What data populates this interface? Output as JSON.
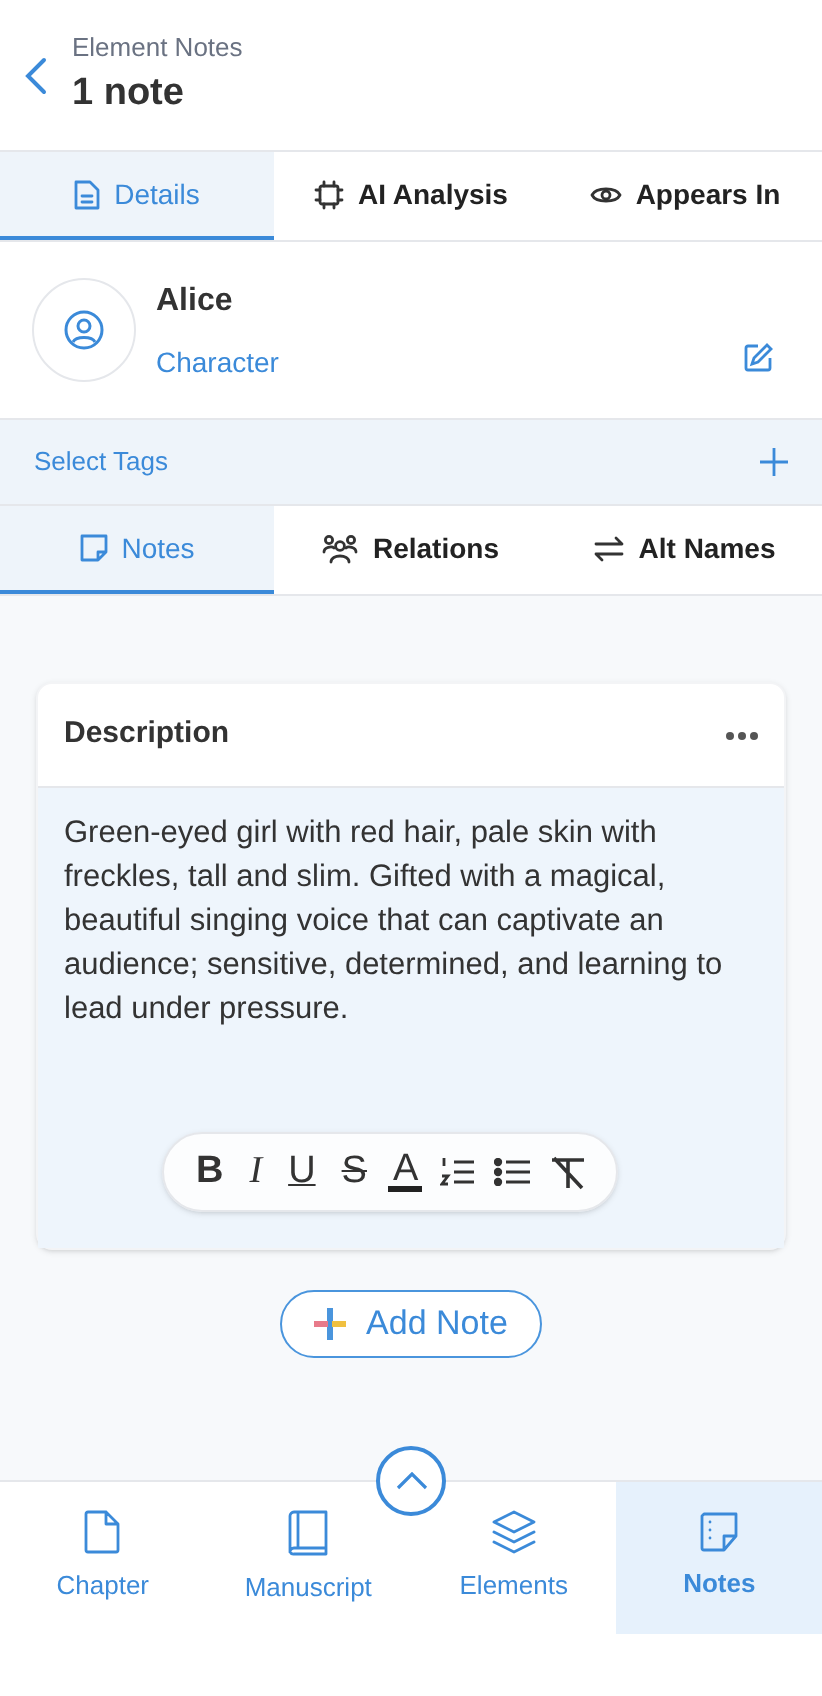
{
  "header": {
    "subtitle": "Element Notes",
    "title": "1 note"
  },
  "tabs": [
    {
      "label": "Details",
      "kind": "details",
      "selected": true
    },
    {
      "label": "AI Analysis",
      "kind": "ai",
      "selected": false
    },
    {
      "label": "Appears In",
      "kind": "eye",
      "selected": false
    }
  ],
  "element": {
    "name": "Alice",
    "type": "Character"
  },
  "tags": {
    "label": "Select Tags"
  },
  "subtabs": [
    {
      "label": "Notes",
      "kind": "notes",
      "selected": true
    },
    {
      "label": "Relations",
      "kind": "relations",
      "selected": false
    },
    {
      "label": "Alt Names",
      "kind": "alt",
      "selected": false
    }
  ],
  "note": {
    "title": "Description",
    "body": "Green-eyed girl with red hair, pale skin with freckles, tall and slim. Gifted with a magical, beautiful singing voice that can captivate an audience; sensitive, determined, and learning to lead under pressure."
  },
  "toolbar": [
    {
      "kind": "bold",
      "label": "B"
    },
    {
      "kind": "italic",
      "label": "I"
    },
    {
      "kind": "underline",
      "label": "U"
    },
    {
      "kind": "strike",
      "label": "S"
    },
    {
      "kind": "color",
      "label": "A"
    },
    {
      "kind": "numbered-list"
    },
    {
      "kind": "bullet-list"
    },
    {
      "kind": "clear-format"
    }
  ],
  "add_button": {
    "label": "Add Note"
  },
  "nav": [
    {
      "label": "Chapter",
      "kind": "chapter",
      "selected": false
    },
    {
      "label": "Manuscript",
      "kind": "manuscript",
      "selected": false
    },
    {
      "label": "Elements",
      "kind": "elements",
      "selected": false
    },
    {
      "label": "Notes",
      "kind": "notes",
      "selected": true
    }
  ]
}
